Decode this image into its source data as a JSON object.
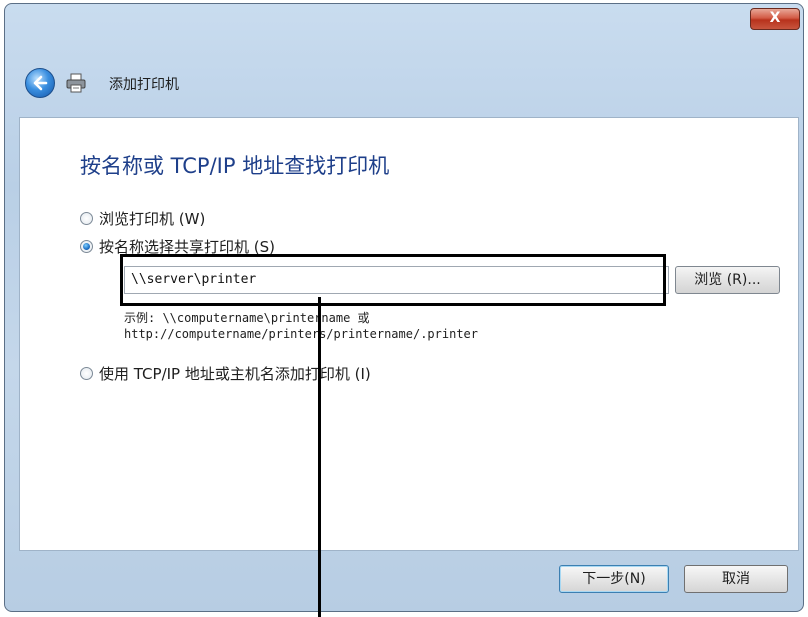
{
  "window": {
    "close_label": "X"
  },
  "header": {
    "title": "添加打印机"
  },
  "content": {
    "heading": "按名称或 TCP/IP 地址查找打印机",
    "options": [
      {
        "label": "浏览打印机 (W)",
        "checked": false
      },
      {
        "label": "按名称选择共享打印机 (S)",
        "checked": true
      },
      {
        "label": "使用 TCP/IP 地址或主机名添加打印机 (I)",
        "checked": false
      }
    ],
    "path_input": {
      "value": "\\\\server\\printer"
    },
    "browse_label": "浏览 (R)...",
    "example_line1": "示例: \\\\computername\\printername 或",
    "example_line2": "http://computername/printers/printername/.printer"
  },
  "footer": {
    "next_label": "下一步(N)",
    "cancel_label": "取消"
  }
}
